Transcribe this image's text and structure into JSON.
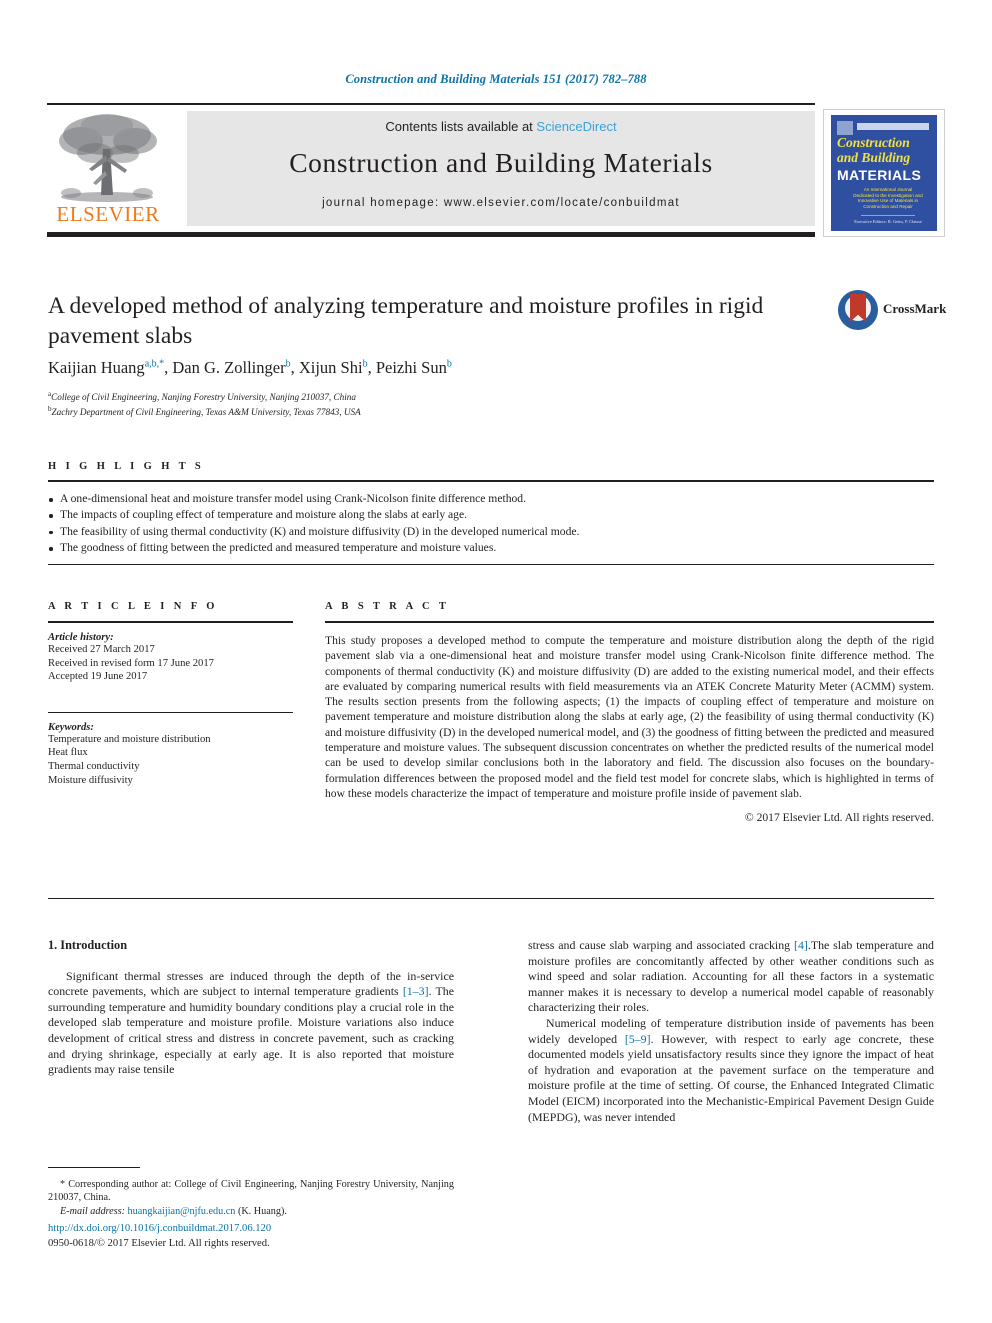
{
  "running_head": "Construction and Building Materials 151 (2017) 782–788",
  "masthead": {
    "contents_prefix": "Contents lists available at ",
    "sciencedirect": "ScienceDirect",
    "journal_name": "Construction and Building Materials",
    "homepage": "journal homepage: www.elsevier.com/locate/conbuildmat",
    "publisher": "ELSEVIER",
    "accent_blue": "#0b73a8",
    "sciencedirect_blue": "#3aa3db",
    "elsevier_orange": "#ee7b1e"
  },
  "cover": {
    "line1": "Construction",
    "line2": "and Building",
    "line3": "MATERIALS",
    "subtitle": "An International Journal Dedicated to the Investigation and Innovative Use of Materials in Construction and Repair",
    "footer": "Executive Editors: R. Gettu, P. Claisse",
    "background": "#2f4fa0",
    "title_color": "#f4e23c"
  },
  "article": {
    "title": "A developed method of analyzing temperature and moisture profiles in rigid pavement slabs",
    "authors": [
      {
        "name": "Kaijian Huang",
        "marks": "a,b,*"
      },
      {
        "name": "Dan G. Zollinger",
        "marks": "b"
      },
      {
        "name": "Xijun Shi",
        "marks": "b"
      },
      {
        "name": "Peizhi Sun",
        "marks": "b"
      }
    ],
    "affiliations": [
      {
        "mark": "a",
        "text": "College of Civil Engineering, Nanjing Forestry University, Nanjing 210037, China"
      },
      {
        "mark": "b",
        "text": "Zachry Department of Civil Engineering, Texas A&M University, Texas 77843, USA"
      }
    ]
  },
  "crossmark": {
    "label": "CrossMark",
    "circle_color": "#2a5d9e",
    "flag_color": "#c0392b"
  },
  "highlights": {
    "label": "H I G H L I G H T S",
    "items": [
      "A one-dimensional heat and moisture transfer model using Crank-Nicolson finite difference method.",
      "The impacts of coupling effect of temperature and moisture along the slabs at early age.",
      "The feasibility of using thermal conductivity (K) and moisture diffusivity (D) in the developed numerical mode.",
      "The goodness of fitting between the predicted and measured temperature and moisture values."
    ]
  },
  "article_info": {
    "label": "A R T I C L E   I N F O",
    "history_heading": "Article history:",
    "history": [
      "Received 27 March 2017",
      "Received in revised form 17 June 2017",
      "Accepted 19 June 2017"
    ],
    "keywords_heading": "Keywords:",
    "keywords": [
      "Temperature and moisture distribution",
      "Heat flux",
      "Thermal conductivity",
      "Moisture diffusivity"
    ]
  },
  "abstract": {
    "label": "A B S T R A C T",
    "text": "This study proposes a developed method to compute the temperature and moisture distribution along the depth of the rigid pavement slab via a one-dimensional heat and moisture transfer model using Crank-Nicolson finite difference method. The components of thermal conductivity (K) and moisture diffusivity (D) are added to the existing numerical model, and their effects are evaluated by comparing numerical results with field measurements via an ATEK Concrete Maturity Meter (ACMM) system. The results section presents from the following aspects; (1) the impacts of coupling effect of temperature and moisture on pavement temperature and moisture distribution along the slabs at early age, (2) the feasibility of using thermal conductivity (K) and moisture diffusivity (D) in the developed numerical model, and (3) the goodness of fitting between the predicted and measured temperature and moisture values. The subsequent discussion concentrates on whether the predicted results of the numerical model can be used to develop similar conclusions both in the laboratory and field. The discussion also focuses on the boundary-formulation differences between the proposed model and the field test model for concrete slabs, which is highlighted in terms of how these models characterize the impact of temperature and moisture profile inside of pavement slab.",
    "copyright": "© 2017 Elsevier Ltd. All rights reserved."
  },
  "introduction": {
    "heading": "1. Introduction",
    "left_p1_a": "Significant thermal stresses are induced through the depth of the in-service concrete pavements, which are subject to internal temperature gradients ",
    "left_cite1": "[1–3]",
    "left_p1_b": ". The surrounding temperature and humidity boundary conditions play a crucial role in the developed slab temperature and moisture profile. Moisture variations also induce development of critical stress and distress in concrete pavement, such as cracking and drying shrinkage, especially at early age. It is also reported that moisture gradients may raise tensile",
    "right_p1_a": "stress and cause slab warping and associated cracking ",
    "right_cite1": "[4]",
    "right_p1_b": ".The slab temperature and moisture profiles are concomitantly affected by other weather conditions such as wind speed and solar radiation. Accounting for all these factors in a systematic manner makes it is necessary to develop a numerical model capable of reasonably characterizing their roles.",
    "right_p2_a": "Numerical modeling of temperature distribution inside of pavements has been widely developed ",
    "right_cite2": "[5–9]",
    "right_p2_b": ". However, with respect to early age concrete, these documented models yield unsatisfactory results since they ignore the impact of heat of hydration and evaporation at the pavement surface on the temperature and moisture profile at the time of setting. Of course, the Enhanced Integrated Climatic Model (EICM) incorporated into the Mechanistic-Empirical Pavement Design Guide (MEPDG), was never intended"
  },
  "footnotes": {
    "corresponding": "* Corresponding author at: College of Civil Engineering, Nanjing Forestry University, Nanjing 210037, China.",
    "email_label": "E-mail address:",
    "email": "huangkaijian@njfu.edu.cn",
    "email_suffix": "(K. Huang).",
    "doi": "http://dx.doi.org/10.1016/j.conbuildmat.2017.06.120",
    "issn": "0950-0618/© 2017 Elsevier Ltd. All rights reserved."
  }
}
